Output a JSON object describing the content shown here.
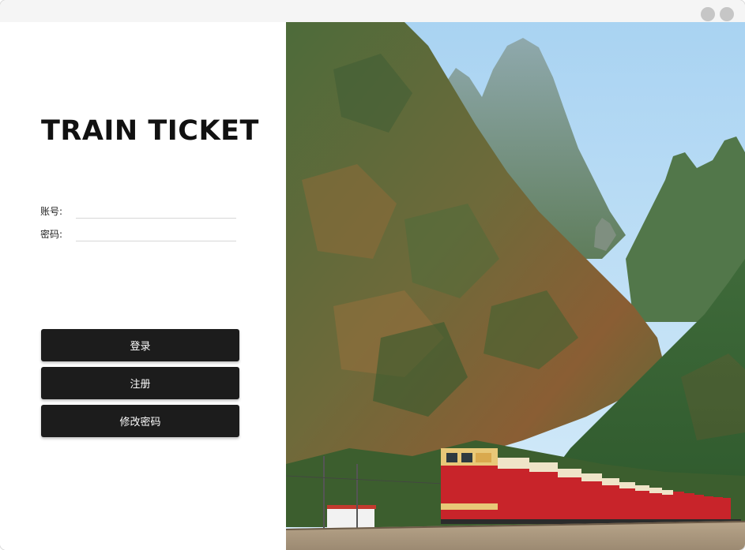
{
  "app": {
    "title": "TRAIN TICKET"
  },
  "form": {
    "account_label": "账号:",
    "account_value": "",
    "password_label": "密码:",
    "password_value": ""
  },
  "buttons": {
    "login": "登录",
    "register": "注册",
    "change_password": "修改密码"
  },
  "colors": {
    "button_bg": "#1c1c1c",
    "button_text": "#ffffff",
    "title_text": "#111111"
  },
  "hero_image": {
    "icon": "mountain-train-photo"
  }
}
